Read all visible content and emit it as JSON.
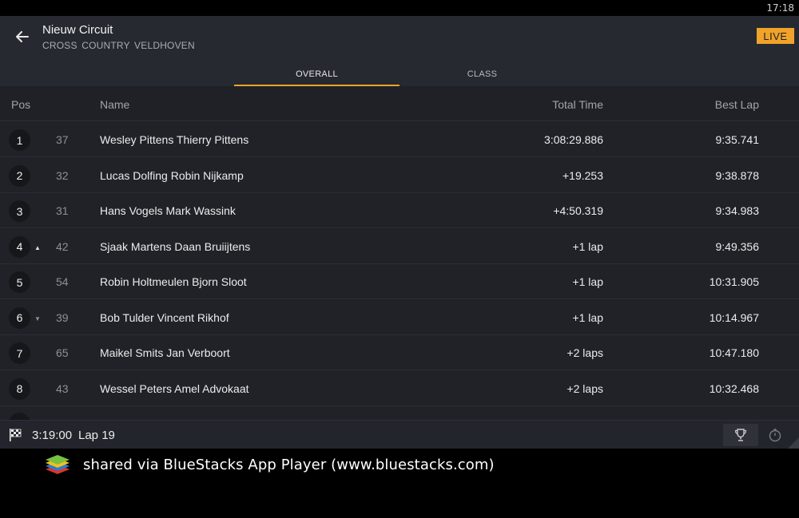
{
  "status_bar": {
    "time": "17:18"
  },
  "header": {
    "title": "Nieuw Circuit",
    "subtitle": "CROSS COUNTRY  VELDHOVEN",
    "live_label": "LIVE",
    "accent_color": "#f0a32a"
  },
  "tabs": [
    {
      "label": "OVERALL",
      "active": true
    },
    {
      "label": "CLASS",
      "active": false
    }
  ],
  "table": {
    "columns": {
      "pos": "Pos",
      "name": "Name",
      "total_time": "Total Time",
      "best_lap": "Best Lap"
    },
    "rows": [
      {
        "pos": "1",
        "trend": "",
        "number": "37",
        "name": "Wesley Pittens Thierry Pittens",
        "total_time": "3:08:29.886",
        "best_lap": "9:35.741"
      },
      {
        "pos": "2",
        "trend": "",
        "number": "32",
        "name": "Lucas Dolfing Robin Nijkamp",
        "total_time": "+19.253",
        "best_lap": "9:38.878"
      },
      {
        "pos": "3",
        "trend": "",
        "number": "31",
        "name": "Hans Vogels Mark Wassink",
        "total_time": "+4:50.319",
        "best_lap": "9:34.983"
      },
      {
        "pos": "4",
        "trend": "up",
        "number": "42",
        "name": "Sjaak Martens Daan Bruiijtens",
        "total_time": "+1 lap",
        "best_lap": "9:49.356"
      },
      {
        "pos": "5",
        "trend": "",
        "number": "54",
        "name": "Robin Holtmeulen Bjorn Sloot",
        "total_time": "+1 lap",
        "best_lap": "10:31.905"
      },
      {
        "pos": "6",
        "trend": "down",
        "number": "39",
        "name": "Bob Tulder Vincent Rikhof",
        "total_time": "+1 lap",
        "best_lap": "10:14.967"
      },
      {
        "pos": "7",
        "trend": "",
        "number": "65",
        "name": "Maikel Smits Jan Verboort",
        "total_time": "+2 laps",
        "best_lap": "10:47.180"
      },
      {
        "pos": "8",
        "trend": "",
        "number": "43",
        "name": "Wessel Peters Amel Advokaat",
        "total_time": "+2 laps",
        "best_lap": "10:32.468"
      }
    ]
  },
  "footer": {
    "race_time": "3:19:00",
    "lap": "Lap 19",
    "icons": [
      "checkered-flag-icon",
      "trophy-icon",
      "stopwatch-icon"
    ]
  },
  "share_bar": {
    "text": "shared via BlueStacks App Player (www.bluestacks.com)",
    "logo_icon": "bluestacks-logo"
  }
}
